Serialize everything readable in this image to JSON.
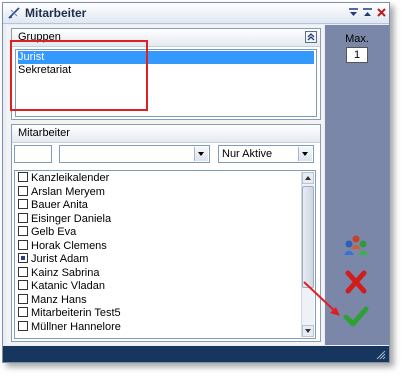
{
  "window": {
    "title": "Mitarbeiter",
    "accent_color": "#17365e",
    "side_panel_color": "#7a87a8"
  },
  "titlebar_buttons": [
    "pin-icon",
    "restore-icon",
    "close-icon"
  ],
  "gruppen": {
    "header": "Gruppen",
    "items": [
      {
        "label": "Jurist",
        "selected": true
      },
      {
        "label": "Sekretariat",
        "selected": false
      }
    ]
  },
  "mitarbeiter": {
    "header": "Mitarbeiter",
    "filter_text_value": "",
    "filter_combo_value": "",
    "status_filter_value": "Nur Aktive",
    "items": [
      {
        "label": "Kanzleikalender",
        "checked": false
      },
      {
        "label": "Arslan Meryem",
        "checked": false
      },
      {
        "label": "Bauer Anita",
        "checked": false
      },
      {
        "label": "Eisinger Daniela",
        "checked": false
      },
      {
        "label": "Gelb Eva",
        "checked": false
      },
      {
        "label": "Horak Clemens",
        "checked": false
      },
      {
        "label": "Jurist Adam",
        "checked": true
      },
      {
        "label": "Kainz Sabrina",
        "checked": false
      },
      {
        "label": "Katanic Vladan",
        "checked": false
      },
      {
        "label": "Manz Hans",
        "checked": false
      },
      {
        "label": "Mitarbeiterin Test5",
        "checked": false
      },
      {
        "label": "Müllner Hannelore",
        "checked": false
      }
    ]
  },
  "side": {
    "max_label": "Max.",
    "max_value": "1",
    "icons": [
      "group-users-icon",
      "cancel-x-icon",
      "confirm-check-icon"
    ]
  }
}
